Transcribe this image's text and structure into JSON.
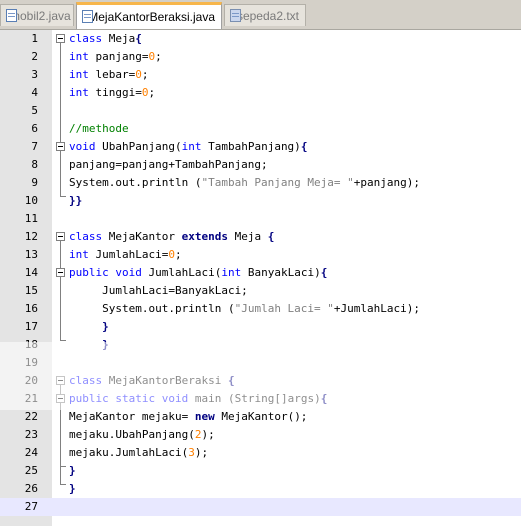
{
  "tabs": [
    {
      "label": "mobil2.java",
      "active": false,
      "icon": "java-file-icon"
    },
    {
      "label": "MejaKantorBeraksi.java",
      "active": true,
      "icon": "java-file-icon"
    },
    {
      "label": "sepeda2.txt",
      "active": false,
      "icon": "text-file-icon"
    }
  ],
  "editor": {
    "current_line": 27,
    "lines": [
      {
        "n": "1"
      },
      {
        "n": "2"
      },
      {
        "n": "3"
      },
      {
        "n": "4"
      },
      {
        "n": "5"
      },
      {
        "n": "6"
      },
      {
        "n": "7"
      },
      {
        "n": "8"
      },
      {
        "n": "9"
      },
      {
        "n": "10"
      },
      {
        "n": "11"
      },
      {
        "n": "12"
      },
      {
        "n": "13"
      },
      {
        "n": "14"
      },
      {
        "n": "15"
      },
      {
        "n": "16"
      },
      {
        "n": "17"
      },
      {
        "n": "18"
      },
      {
        "n": "19"
      },
      {
        "n": "20"
      },
      {
        "n": "21"
      },
      {
        "n": "22"
      },
      {
        "n": "23"
      },
      {
        "n": "24"
      },
      {
        "n": "25"
      },
      {
        "n": "26"
      },
      {
        "n": "27"
      }
    ],
    "code": {
      "l1_kw": "class",
      "l1_rest": " Meja",
      "l1_brace": "{",
      "l2_kw": "int",
      "l2_rest": " panjang=",
      "l2_num": "0",
      "l2_end": ";",
      "l3_kw": "int",
      "l3_rest": " lebar=",
      "l3_num": "0",
      "l3_end": ";",
      "l4_kw": "int",
      "l4_rest": " tinggi=",
      "l4_num": "0",
      "l4_end": ";",
      "l6_cmt": "//methode",
      "l7_kw": "void",
      "l7_a": " UbahPanjang(",
      "l7_kw2": "int",
      "l7_b": " TambahPanjang)",
      "l7_brace": "{",
      "l8": "panjang=panjang+TambahPanjang;",
      "l9_a": "System.out.println (",
      "l9_str": "\"Tambah Panjang Meja= \"",
      "l9_b": "+panjang);",
      "l10_brace": "}}",
      "l12_kw": "class",
      "l12_a": " MejaKantor ",
      "l12_kw2": "extends",
      "l12_b": " Meja ",
      "l12_brace": "{",
      "l13_kw": "int",
      "l13_a": " JumlahLaci=",
      "l13_num": "0",
      "l13_end": ";",
      "l14_kw": "public",
      "l14_kw2": "void",
      "l14_a": " JumlahLaci(",
      "l14_kw3": "int",
      "l14_b": " BanyakLaci)",
      "l14_brace": "{",
      "l15": "     JumlahLaci=BanyakLaci;",
      "l16_a": "     System.out.println (",
      "l16_str": "\"Jumlah Laci= \"",
      "l16_b": "+JumlahLaci);",
      "l17_brace": "     }",
      "l18_brace": "     }",
      "l20_kw": "class",
      "l20_a": " MejaKantorBeraksi ",
      "l20_brace": "{",
      "l21_kw": "public",
      "l21_kw2": "static",
      "l21_kw3": "void",
      "l21_a": " main (String[]args)",
      "l21_brace": "{",
      "l22_a": "MejaKantor mejaku= ",
      "l22_kw": "new",
      "l22_b": " MejaKantor();",
      "l23_a": "mejaku.UbahPanjang(",
      "l23_num": "2",
      "l23_b": ");",
      "l24_a": "mejaku.JumlahLaci(",
      "l24_num": "3",
      "l24_b": ");",
      "l25_brace": "}",
      "l26_brace": "}"
    }
  },
  "colors": {
    "keyword": "#0000ff",
    "number": "#ff8000",
    "string": "#808080",
    "comment": "#008000",
    "active_tab_accent": "#f7b64b",
    "current_line": "#e8e8ff"
  }
}
